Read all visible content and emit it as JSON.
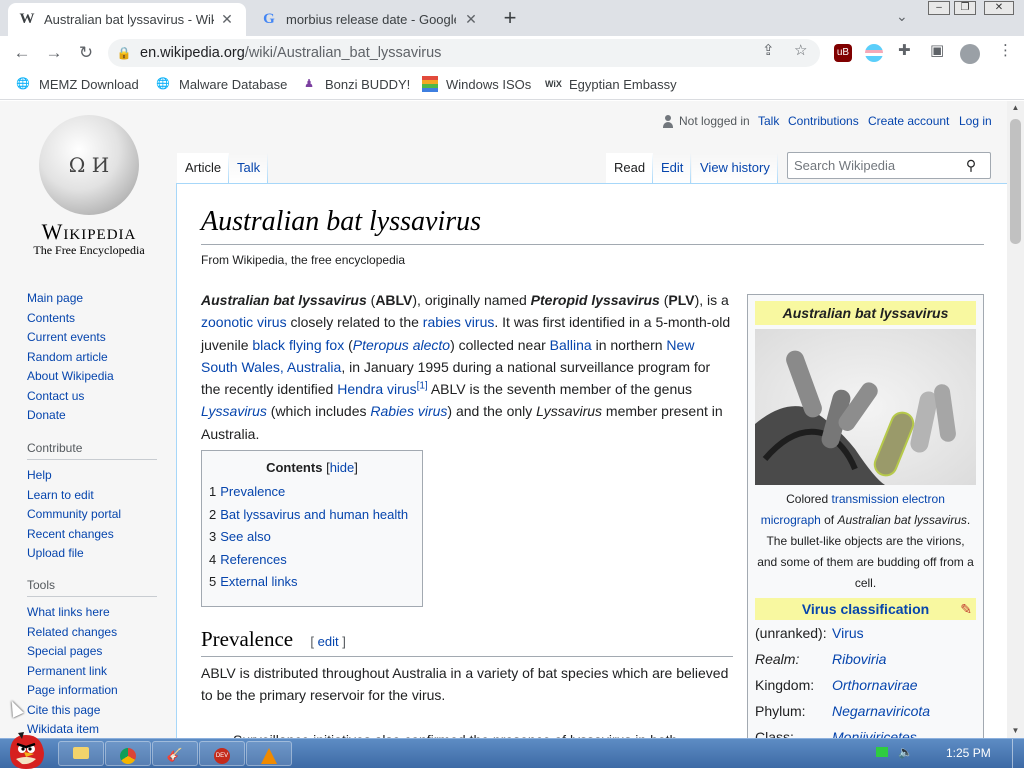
{
  "browser": {
    "tabs": [
      {
        "favicon": "W",
        "title": "Australian bat lyssavirus - Wiki",
        "close": "✕"
      },
      {
        "favicon": "G",
        "title": "morbius release date - Google",
        "close": "✕"
      }
    ],
    "new_tab": "+",
    "tab_search": "⌄",
    "url_host": "en.wikipedia.org",
    "url_path": "/wiki/Australian_bat_lyssavirus",
    "bookmarks": [
      {
        "icon": "globe-icon",
        "label": "MEMZ Download"
      },
      {
        "icon": "globe-icon",
        "label": "Malware Database"
      },
      {
        "icon": "bonzi-icon",
        "label": "Bonzi BUDDY!"
      },
      {
        "icon": "windows-flag-icon",
        "label": "Windows ISOs"
      },
      {
        "icon": "wix-icon",
        "label": "Egyptian Embassy"
      }
    ]
  },
  "wiki": {
    "wordmark": "Wikipedia",
    "tagline": "The Free Encyclopedia",
    "nav": [
      "Main page",
      "Contents",
      "Current events",
      "Random article",
      "About Wikipedia",
      "Contact us",
      "Donate"
    ],
    "contribute_heading": "Contribute",
    "contribute": [
      "Help",
      "Learn to edit",
      "Community portal",
      "Recent changes",
      "Upload file"
    ],
    "tools_heading": "Tools",
    "tools": [
      "What links here",
      "Related changes",
      "Special pages",
      "Permanent link",
      "Page information",
      "Cite this page",
      "Wikidata item"
    ],
    "personal": {
      "not_logged_in": "Not logged in",
      "talk": "Talk",
      "contributions": "Contributions",
      "create_account": "Create account",
      "log_in": "Log in"
    },
    "tabs": {
      "article": "Article",
      "talk": "Talk",
      "read": "Read",
      "edit": "Edit",
      "history": "View history"
    },
    "search_placeholder": "Search Wikipedia",
    "title": "Australian bat lyssavirus",
    "from": "From Wikipedia, the free encyclopedia",
    "intro": {
      "t1": "Australian bat lyssavirus",
      "t2": " (",
      "t3": "ABLV",
      "t4": "), originally named ",
      "t5": "Pteropid lyssavirus",
      "t6": " (",
      "t7": "PLV",
      "t8": "), is a ",
      "l1": "zoonotic virus",
      "t9": " closely related to the ",
      "l2": "rabies virus",
      "t10": ". It was first identified in a 5-month-old juvenile ",
      "l3": "black flying fox",
      "t11": " (",
      "l4": "Pteropus alecto",
      "t12": ") collected near ",
      "l5": "Ballina",
      "t13": " in northern ",
      "l6": "New South Wales, Australia",
      "t14": ", in January 1995 during a national surveillance program for the recently identified ",
      "l7": "Hendra virus",
      "ref": "[1]",
      "t15": " ABLV is the seventh member of the genus ",
      "l8": "Lyssavirus",
      "t16": " (which includes ",
      "l9": "Rabies virus",
      "t17": ") and the only ",
      "t18": "Lyssavirus",
      "t19": " member present in Australia."
    },
    "toc": {
      "title": "Contents",
      "hide_open": "[",
      "hide": "hide",
      "hide_close": "]",
      "items": [
        {
          "num": "1",
          "label": "Prevalence"
        },
        {
          "num": "2",
          "label": "Bat lyssavirus and human health"
        },
        {
          "num": "3",
          "label": "See also"
        },
        {
          "num": "4",
          "label": "References"
        },
        {
          "num": "5",
          "label": "External links"
        }
      ]
    },
    "section": {
      "title": "Prevalence",
      "edit_open": "[ ",
      "edit": "edit",
      "edit_close": " ]"
    },
    "prevalence_text": "ABLV is distributed throughout Australia in a variety of bat species which are believed to be the primary reservoir for the virus.",
    "prevalence_text2": "Surveillance initiatives also confirmed the presence of lyssavirus in both",
    "infobox": {
      "title": "Australian bat lyssavirus",
      "caption_pre": "Colored ",
      "caption_link": "transmission electron micrograph",
      "caption_mid": " of ",
      "caption_it": "Australian bat lyssavirus",
      "caption_post": ". The bullet-like objects are the virions, and some of them are budding off from a cell.",
      "classification": "Virus classification",
      "rows": [
        {
          "key": "(unranked):",
          "value": "Virus"
        },
        {
          "key": "Realm:",
          "value": "Riboviria"
        },
        {
          "key": "Kingdom:",
          "value": "Orthornavirae"
        },
        {
          "key": "Phylum:",
          "value": "Negarnaviricota"
        },
        {
          "key": "Class:",
          "value": "Monjiviricetes"
        }
      ]
    }
  },
  "taskbar": {
    "apps": [
      "folder-icon",
      "chrome-icon",
      "bonzi-icon",
      "devcpp-icon",
      "vlc-icon"
    ],
    "clock": "1:25 PM"
  }
}
